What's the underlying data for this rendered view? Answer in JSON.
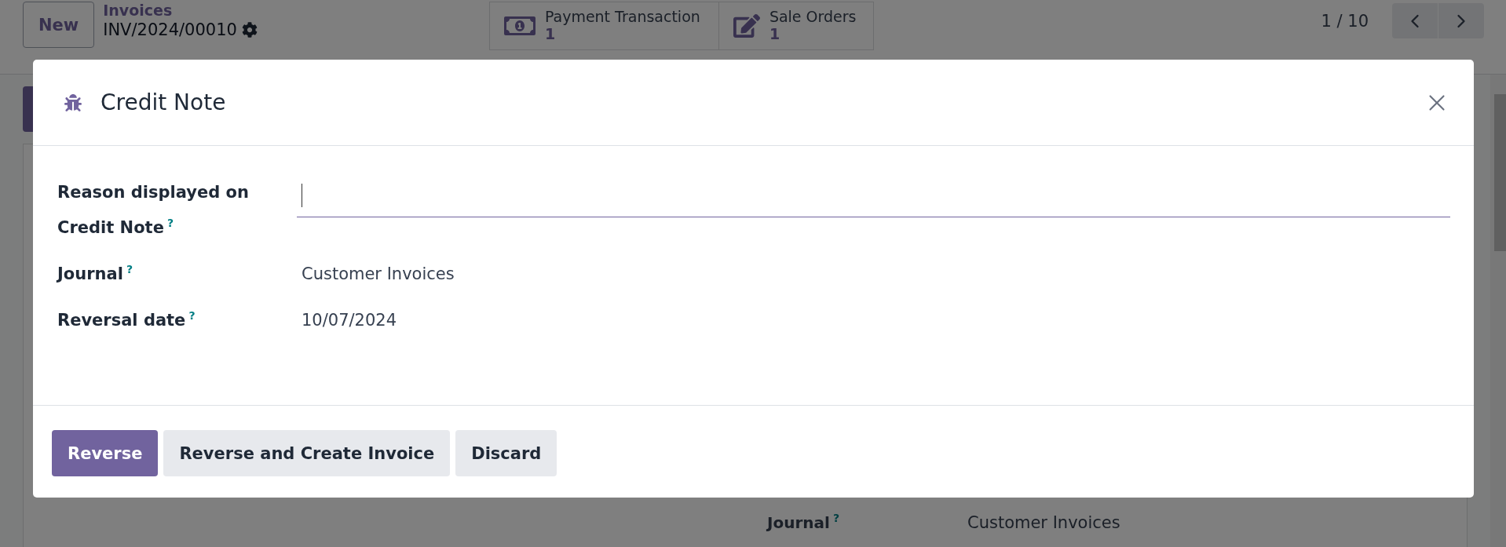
{
  "control_panel": {
    "new_button": "New",
    "breadcrumb": "Invoices",
    "record": "INV/2024/00010",
    "smart_buttons": [
      {
        "kind": "money",
        "label": "Payment Transaction",
        "count": "1"
      },
      {
        "kind": "edit",
        "label": "Sale Orders",
        "count": "1"
      }
    ],
    "pager": "1 / 10"
  },
  "form": {
    "right_fields": [
      {
        "label": "Journal",
        "help": "?",
        "value": "Customer Invoices"
      }
    ]
  },
  "dialog": {
    "title": "Credit Note",
    "fields": [
      {
        "kind": "input",
        "label": "Reason displayed on Credit Note",
        "help": "?"
      },
      {
        "kind": "text",
        "label": "Journal",
        "help": "?",
        "value": "Customer Invoices"
      },
      {
        "kind": "text",
        "label": "Reversal date",
        "help": "?",
        "value": "10/07/2024"
      }
    ],
    "buttons": [
      {
        "kind": "primary",
        "label": "Reverse"
      },
      {
        "kind": "secondary",
        "label": "Reverse and Create Invoice"
      },
      {
        "kind": "secondary",
        "label": "Discard"
      }
    ]
  }
}
